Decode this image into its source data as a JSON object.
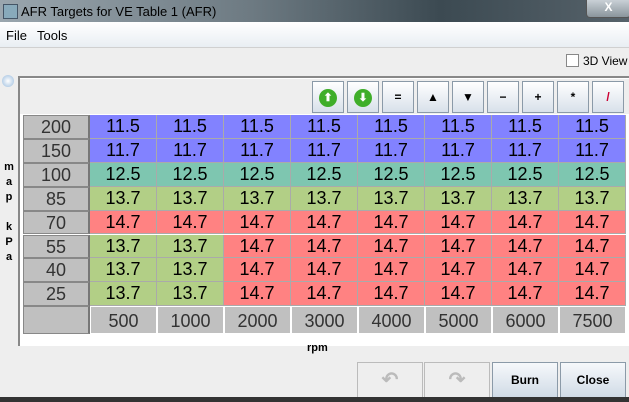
{
  "window": {
    "title": "AFR Targets for VE Table 1 (AFR)",
    "close": "X"
  },
  "menu": [
    "File",
    "Tools"
  ],
  "view3d": "3D View",
  "toolbar": [
    {
      "name": "increment-button",
      "glyph": "⬆"
    },
    {
      "name": "decrement-button",
      "glyph": "⬇"
    },
    {
      "name": "set-equal-button",
      "glyph": "="
    },
    {
      "name": "raise-button",
      "glyph": "▲"
    },
    {
      "name": "lower-button",
      "glyph": "▼"
    },
    {
      "name": "subtract-button",
      "glyph": "−"
    },
    {
      "name": "add-button",
      "glyph": "+"
    },
    {
      "name": "multiply-button",
      "glyph": "*"
    },
    {
      "name": "interpolate-button",
      "glyph": "/"
    }
  ],
  "y_axis_label": "map kPa",
  "y_axis_letters": [
    "m",
    "a",
    "p",
    "",
    "k",
    "P",
    "a"
  ],
  "x_axis_label": "rpm",
  "y_axis": [
    "200",
    "150",
    "100",
    "85",
    "70",
    "55",
    "40",
    "25"
  ],
  "x_axis": [
    "500",
    "1000",
    "2000",
    "3000",
    "4000",
    "5000",
    "6000",
    "7500"
  ],
  "rows": [
    [
      "11.5",
      "11.5",
      "11.5",
      "11.5",
      "11.5",
      "11.5",
      "11.5",
      "11.5"
    ],
    [
      "11.7",
      "11.7",
      "11.7",
      "11.7",
      "11.7",
      "11.7",
      "11.7",
      "11.7"
    ],
    [
      "12.5",
      "12.5",
      "12.5",
      "12.5",
      "12.5",
      "12.5",
      "12.5",
      "12.5"
    ],
    [
      "13.7",
      "13.7",
      "13.7",
      "13.7",
      "13.7",
      "13.7",
      "13.7",
      "13.7"
    ],
    [
      "14.7",
      "14.7",
      "14.7",
      "14.7",
      "14.7",
      "14.7",
      "14.7",
      "14.7"
    ],
    [
      "13.7",
      "13.7",
      "14.7",
      "14.7",
      "14.7",
      "14.7",
      "14.7",
      "14.7"
    ],
    [
      "13.7",
      "13.7",
      "14.7",
      "14.7",
      "14.7",
      "14.7",
      "14.7",
      "14.7"
    ],
    [
      "13.7",
      "13.7",
      "14.7",
      "14.7",
      "14.7",
      "14.7",
      "14.7",
      "14.7"
    ]
  ],
  "colors": {
    "11.5": "#8282ff",
    "11.7": "#8282ff",
    "12.5": "#7ec6b0",
    "13.7": "#b2cf86",
    "14.7": "#ff8282"
  },
  "buttons": {
    "undo": "↶",
    "redo": "↷",
    "burn": "Burn",
    "close": "Close"
  }
}
